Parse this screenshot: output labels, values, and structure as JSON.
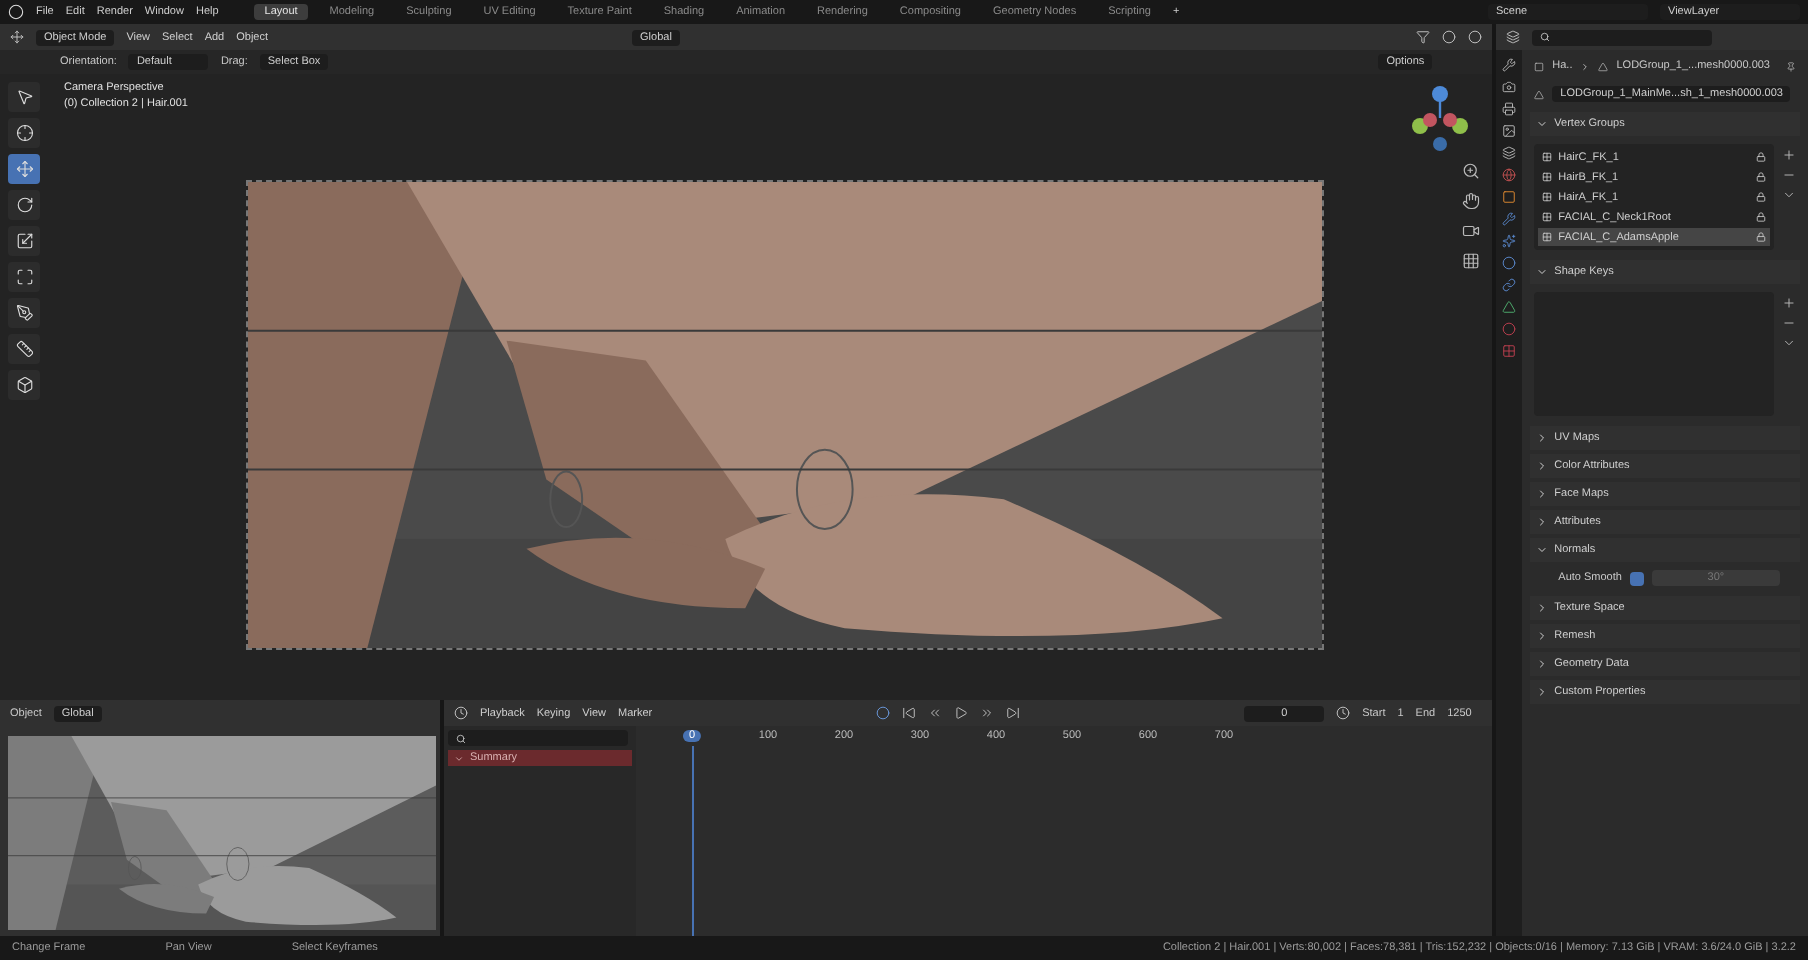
{
  "menus": [
    "File",
    "Edit",
    "Render",
    "Window",
    "Help"
  ],
  "workspaces": [
    {
      "label": "Layout",
      "selected": true
    },
    {
      "label": "Modeling",
      "selected": false
    },
    {
      "label": "Sculpting",
      "selected": false
    },
    {
      "label": "UV Editing",
      "selected": false
    },
    {
      "label": "Texture Paint",
      "selected": false
    },
    {
      "label": "Shading",
      "selected": false
    },
    {
      "label": "Animation",
      "selected": false
    },
    {
      "label": "Rendering",
      "selected": false
    },
    {
      "label": "Compositing",
      "selected": false
    },
    {
      "label": "Geometry Nodes",
      "selected": false
    },
    {
      "label": "Scripting",
      "selected": false
    }
  ],
  "add_workspace": "+",
  "scene": "Scene",
  "view_layer": "ViewLayer",
  "viewport": {
    "mode": "Object Mode",
    "menus": [
      "View",
      "Select",
      "Add",
      "Object"
    ],
    "orientation": "Global",
    "tool_settings": {
      "orientation_label": "Orientation:",
      "orientation": "Default",
      "drag_label": "Drag:",
      "drag": "Select Box",
      "options": "Options"
    },
    "overlay": [
      "Camera Perspective",
      "(0) Collection 2 | Hair.001"
    ],
    "tools": [
      {
        "selected": false
      },
      {
        "selected": false
      },
      {
        "selected": true
      },
      {
        "selected": false
      },
      {
        "selected": false
      },
      {
        "selected": false
      },
      {
        "selected": false
      },
      {
        "selected": false
      },
      {
        "selected": false
      }
    ]
  },
  "properties": {
    "breadcrumb": [
      "Ha..",
      "LODGroup_1_...mesh0000.003"
    ],
    "mesh_name": "LODGroup_1_MainMe...sh_1_mesh0000.003",
    "panels": [
      {
        "kind": "list",
        "title": "Vertex Groups",
        "expanded": true,
        "items": [
          {
            "label": "HairC_FK_1",
            "selected": false
          },
          {
            "label": "HairB_FK_1",
            "selected": false
          },
          {
            "label": "HairA_FK_1",
            "selected": false
          },
          {
            "label": "FACIAL_C_Neck1Root",
            "selected": false
          },
          {
            "label": "FACIAL_C_AdamsApple",
            "selected": true
          }
        ]
      },
      {
        "kind": "shape_keys",
        "title": "Shape Keys",
        "expanded": true
      },
      {
        "kind": "plain",
        "title": "UV Maps",
        "expanded": false
      },
      {
        "kind": "plain",
        "title": "Color Attributes",
        "expanded": false
      },
      {
        "kind": "plain",
        "title": "Face Maps",
        "expanded": false
      },
      {
        "kind": "plain",
        "title": "Attributes",
        "expanded": false
      },
      {
        "kind": "normals",
        "title": "Normals",
        "expanded": true,
        "auto_smooth": {
          "label": "Auto Smooth",
          "checked": true,
          "angle": "30°"
        }
      },
      {
        "kind": "plain",
        "title": "Texture Space",
        "expanded": false
      },
      {
        "kind": "plain",
        "title": "Remesh",
        "expanded": false
      },
      {
        "kind": "plain",
        "title": "Geometry Data",
        "expanded": false
      },
      {
        "kind": "plain",
        "title": "Custom Properties",
        "expanded": false
      }
    ]
  },
  "preview": {
    "mode": "Object",
    "orientation": "Global"
  },
  "timeline": {
    "menus": [
      "Playback",
      "Keying",
      "View",
      "Marker"
    ],
    "current_frame": "0",
    "start_label": "Start",
    "start": "1",
    "end_label": "End",
    "end": "1250",
    "ruler": [
      {
        "label": "0",
        "selected": true
      },
      {
        "label": "100",
        "selected": false
      },
      {
        "label": "200",
        "selected": false
      },
      {
        "label": "300",
        "selected": false
      },
      {
        "label": "400",
        "selected": false
      },
      {
        "label": "500",
        "selected": false
      },
      {
        "label": "600",
        "selected": false
      },
      {
        "label": "700",
        "selected": false
      }
    ],
    "channels": [
      "Summary"
    ]
  },
  "status": {
    "hints": [
      "Change Frame",
      "Pan View",
      "Select Keyframes"
    ],
    "stats": "Collection 2 | Hair.001 | Verts:80,002 | Faces:78,381 | Tris:152,232 | Objects:0/16 | Memory: 7.13 GiB | VRAM: 3.6/24.0 GiB | 3.2.2"
  }
}
